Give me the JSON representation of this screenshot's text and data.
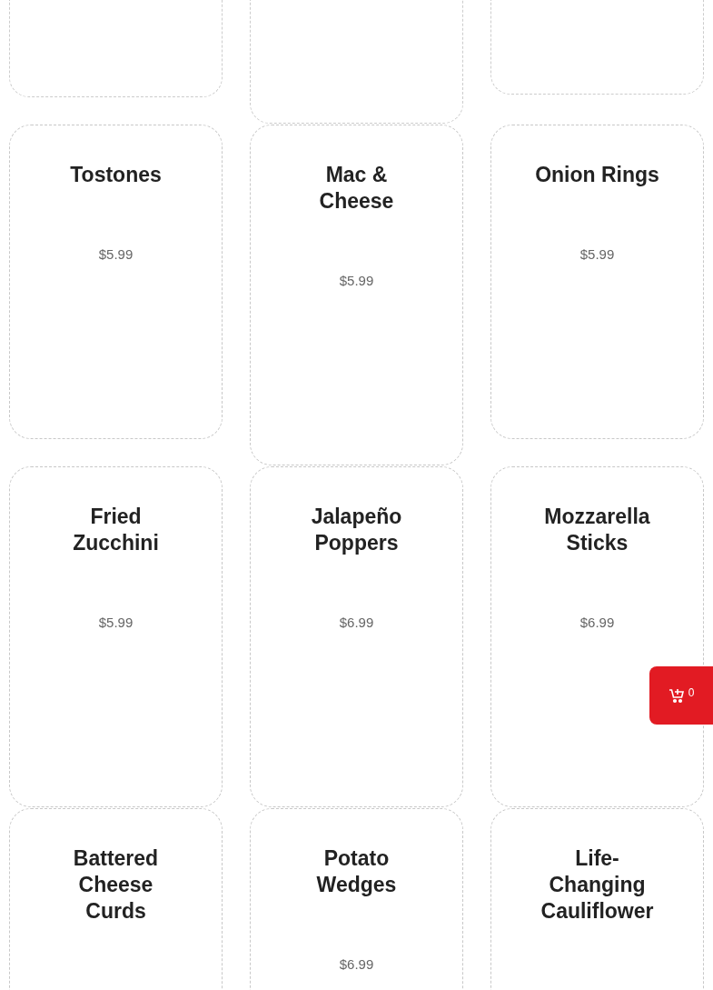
{
  "products": [
    {
      "name": "Tostones",
      "price": "$5.99"
    },
    {
      "name": "Mac & Cheese",
      "price": "$5.99"
    },
    {
      "name": "Onion Rings",
      "price": "$5.99"
    },
    {
      "name": "Fried Zucchini",
      "price": "$5.99"
    },
    {
      "name": "Jalapeño Poppers",
      "price": "$6.99"
    },
    {
      "name": "Mozzarella Sticks",
      "price": "$6.99"
    },
    {
      "name": "Battered Cheese Curds"
    },
    {
      "name": "Potato Wedges",
      "price": "$6.99"
    },
    {
      "name": "Life-Changing Cauliflower"
    }
  ],
  "cart": {
    "count": "0"
  }
}
